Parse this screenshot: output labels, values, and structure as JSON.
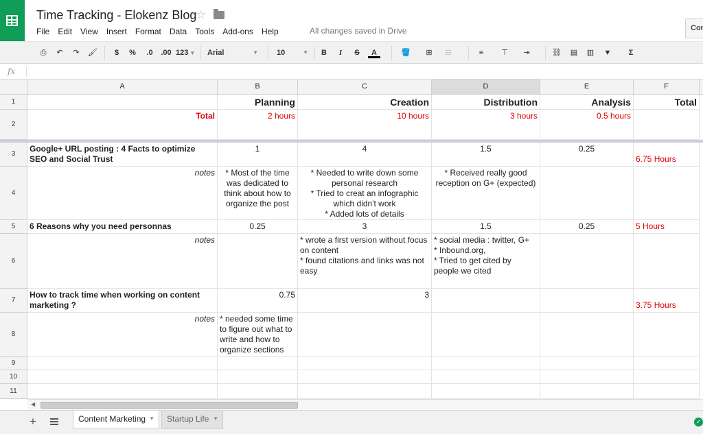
{
  "header": {
    "title": "Time Tracking - Elokenz Blog",
    "menu": [
      "File",
      "Edit",
      "View",
      "Insert",
      "Format",
      "Data",
      "Tools",
      "Add-ons",
      "Help"
    ],
    "save_status": "All changes saved in Drive",
    "comments_label": "Comments"
  },
  "toolbar": {
    "currency": "$",
    "percent": "%",
    "decrease_decimals": ".0",
    "increase_decimals": ".00",
    "more_formats": "123",
    "font": "Arial",
    "font_size": "10",
    "bold": "B",
    "italic": "I",
    "strikethrough": "S",
    "text_color": "A",
    "functions": "Σ"
  },
  "formula_bar": {
    "fx": "fx",
    "value": ""
  },
  "columns": [
    "A",
    "B",
    "C",
    "D",
    "E",
    "F"
  ],
  "rows": {
    "r1": {
      "num": "1",
      "b": "Planning",
      "c": "Creation",
      "d": "Distribution",
      "e": "Analysis",
      "f": "Total"
    },
    "r2": {
      "num": "2",
      "a": "Total",
      "b": "2 hours",
      "c": "10 hours",
      "d": "3 hours",
      "e": "0.5 hours"
    },
    "r3": {
      "num": "3",
      "a": "Google+ URL posting : 4 Facts to optimize SEO and Social Trust",
      "b": "1",
      "c": "4",
      "d": "1.5",
      "e": "0.25",
      "f": "6.75 Hours"
    },
    "r4": {
      "num": "4",
      "a": "notes",
      "b": "* Most of the time was dedicated to think about how to organize the post",
      "c": "* Needed to write down some personal research\n* Tried to creat an infographic which didn't work\n* Added lots of details",
      "d": "* Received really good reception on G+ (expected)"
    },
    "r5": {
      "num": "5",
      "a": "6 Reasons why you need personnas",
      "b": "0.25",
      "c": "3",
      "d": "1.5",
      "e": "0.25",
      "f": "5 Hours"
    },
    "r6": {
      "num": "6",
      "a": "notes",
      "c": "* wrote a first version without focus on content\n* found citations and links was not easy",
      "d": "* social media : twitter, G+\n* Inbound.org,\n* Tried to get cited by people we cited"
    },
    "r7": {
      "num": "7",
      "a": "How to track time when working on content marketing ?",
      "b": "0.75",
      "c": "3",
      "f": "3.75 Hours"
    },
    "r8": {
      "num": "8",
      "a": "notes",
      "b": "* needed some time to figure out what to write and how to organize sections"
    },
    "r9": {
      "num": "9"
    },
    "r10": {
      "num": "10"
    },
    "r11": {
      "num": "11"
    }
  },
  "sheets": [
    {
      "label": "Content Marketing",
      "active": true
    },
    {
      "label": "Startup Life",
      "active": false
    }
  ],
  "colors": {
    "accent_green": "#0f9d58",
    "red_text": "#e00000"
  }
}
